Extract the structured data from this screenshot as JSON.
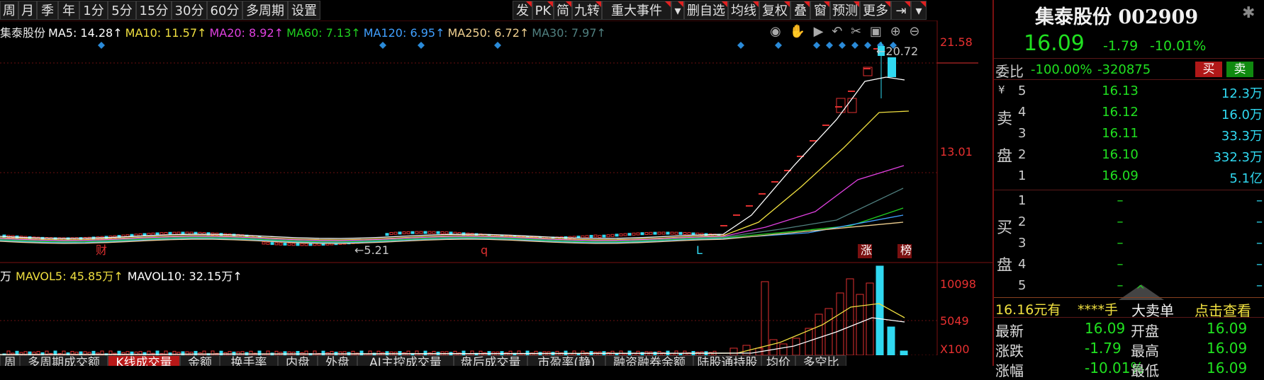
{
  "toolbar": {
    "left": [
      "周",
      "月",
      "季",
      "年",
      "1分",
      "5分",
      "15分",
      "30分",
      "60分",
      "多周期",
      "设置"
    ],
    "right": [
      "发",
      "PK",
      "简",
      "九转",
      "重大事件",
      "▾",
      "删自选",
      "均线",
      "复权",
      "叠",
      "窗",
      "预测",
      "更多",
      "⇥",
      "▾"
    ]
  },
  "legend": [
    {
      "t": "集泰股份",
      "c": "#e8e8e8"
    },
    {
      "t": "MA5: 14.28↑",
      "c": "#ffffff"
    },
    {
      "t": "MA10: 11.57↑",
      "c": "#f0e040"
    },
    {
      "t": "MA20: 8.92↑",
      "c": "#e040e0"
    },
    {
      "t": "MA60: 7.13↑",
      "c": "#20d020"
    },
    {
      "t": "MA120: 6.95↑",
      "c": "#40a0ff"
    },
    {
      "t": "MA250: 6.72↑",
      "c": "#f0d090"
    },
    {
      "t": "MA30: 7.97↑",
      "c": "#508080"
    }
  ],
  "price_axis": [
    "21.58",
    "13.01"
  ],
  "vol_axis": [
    "10098",
    "5049",
    "X100"
  ],
  "annotations": {
    "high": "←20.72",
    "low": "←5.21",
    "markers": [
      "财",
      "q",
      "L",
      "涨",
      "榜"
    ]
  },
  "vol_legend": [
    {
      "t": "万",
      "c": "#fff"
    },
    {
      "t": "MAVOL5: 45.85万↑",
      "c": "#f0e040"
    },
    {
      "t": "MAVOL10: 32.15万↑",
      "c": "#ffffff"
    }
  ],
  "bottom_tabs": [
    "周",
    "多周期成交额",
    "K线成交量",
    "金额",
    "换手率",
    "内盘",
    "外盘",
    "AI主控成交量",
    "盘后成交量",
    "市盈率(静)",
    "融资融券余额",
    "陆股通持股",
    "均价",
    "多空比"
  ],
  "quote": {
    "name_code": "集泰股份 002909",
    "price": "16.09",
    "change": "-1.79",
    "pct": "-10.01%",
    "weibi_label": "委比",
    "weibi": "-100.00%",
    "weibi_vol": "-320875",
    "buy": "买",
    "sell": "卖",
    "sell_side_label": [
      "卖",
      "盘"
    ],
    "buy_side_label": [
      "买",
      "盘"
    ],
    "yen": "¥",
    "asks": [
      {
        "n": "5",
        "p": "16.13",
        "v": "12.3万"
      },
      {
        "n": "4",
        "p": "16.12",
        "v": "16.0万"
      },
      {
        "n": "3",
        "p": "16.11",
        "v": "33.3万"
      },
      {
        "n": "2",
        "p": "16.10",
        "v": "332.3万"
      },
      {
        "n": "1",
        "p": "16.09",
        "v": "5.1亿"
      }
    ],
    "bids": [
      {
        "n": "1",
        "p": "–",
        "v": "–"
      },
      {
        "n": "2",
        "p": "–",
        "v": "–"
      },
      {
        "n": "3",
        "p": "–",
        "v": "–"
      },
      {
        "n": "4",
        "p": "–",
        "v": "–"
      },
      {
        "n": "5",
        "p": "–",
        "v": "–"
      }
    ],
    "bigorder": {
      "price": "16.16元有",
      "hands": "****手",
      "label": "大卖单",
      "action": "点击查看"
    },
    "stats": [
      {
        "l": "最新",
        "v": "16.09",
        "l2": "开盘",
        "v2": "16.09"
      },
      {
        "l": "涨跌",
        "v": "-1.79",
        "l2": "最高",
        "v2": "16.09"
      },
      {
        "l": "涨幅",
        "v": "-10.01%",
        "l2": "最低",
        "v2": "16.09"
      }
    ]
  }
}
